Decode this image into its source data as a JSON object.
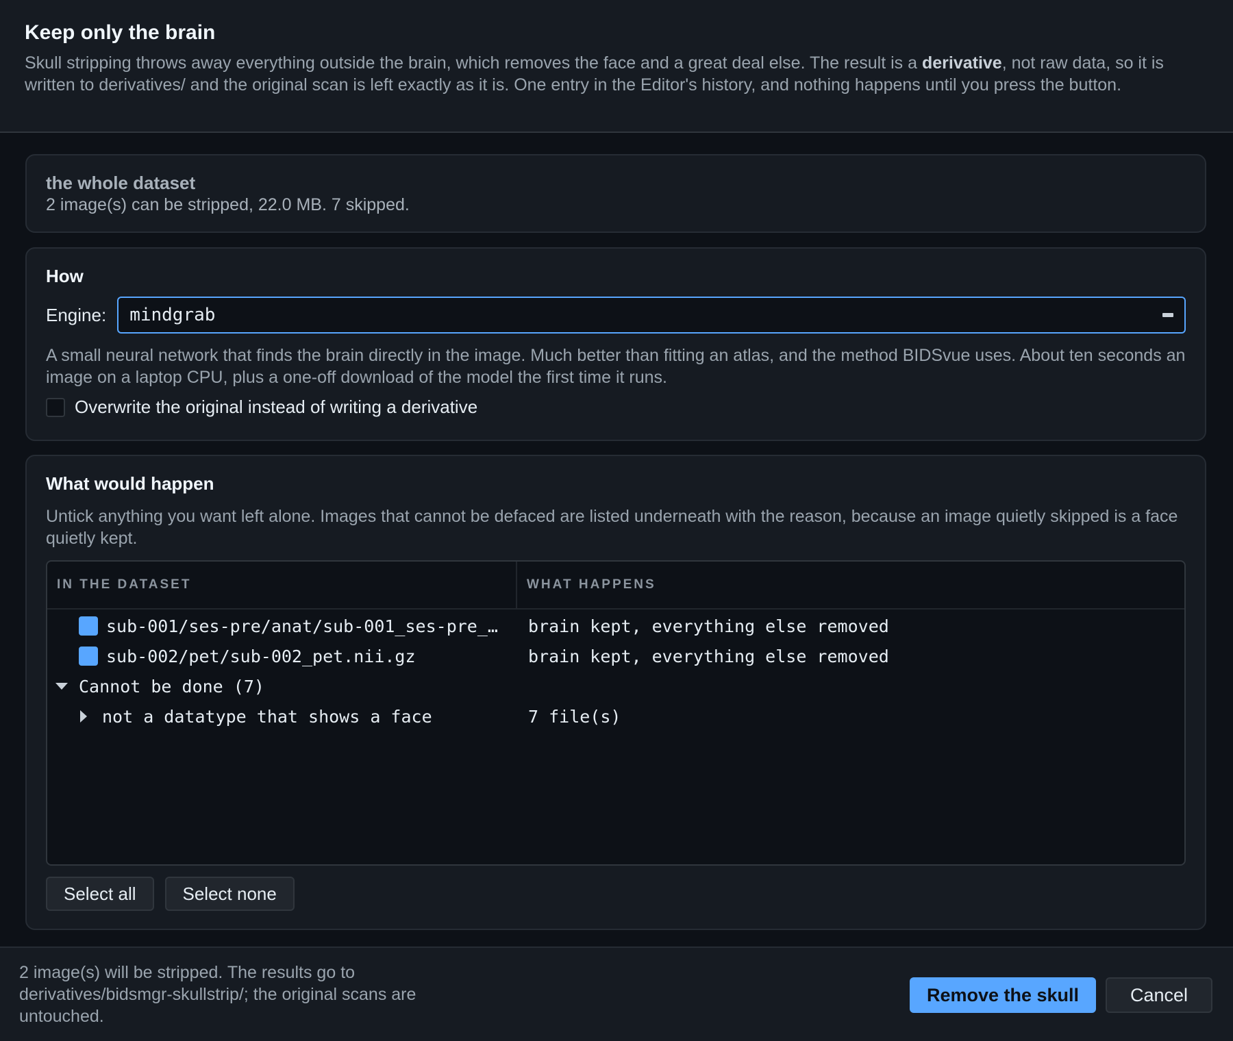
{
  "dialog": {
    "title": "Keep only the brain",
    "intro_pre": "Skull stripping throws away everything outside the brain, which removes the face and a great deal else. The result is a ",
    "intro_bold": "derivative",
    "intro_post": ", not raw data, so it is written to derivatives/ and the original scan is left exactly as it is. One entry in the Editor's history, and nothing happens until you press the button."
  },
  "scope": {
    "name": "the whole dataset",
    "summary": "2 image(s) can be stripped, 22.0 MB. 7 skipped."
  },
  "how": {
    "title": "How",
    "engine_label": "Engine:",
    "engine_value": "mindgrab",
    "description": "A small neural network that finds the brain directly in the image. Much better than fitting an atlas, and the method BIDSvue uses. About ten seconds an image on a laptop CPU, plus a one-off download of the model the first time it runs.",
    "overwrite_label": "Overwrite the original instead of writing a derivative",
    "overwrite_checked": false
  },
  "what": {
    "title": "What would happen",
    "description": "Untick anything you want left alone. Images that cannot be defaced are listed underneath with the reason, because an image quietly skipped is a face quietly kept.",
    "columns": [
      "IN THE DATASET",
      "WHAT HAPPENS"
    ],
    "rows": [
      {
        "path": "sub-001/ses-pre/anat/sub-001_ses-pre_…",
        "result": "brain kept, everything else removed",
        "checked": true
      },
      {
        "path": "sub-002/pet/sub-002_pet.nii.gz",
        "result": "brain kept, everything else removed",
        "checked": true
      }
    ],
    "skipped_group": "Cannot be done (7)",
    "skipped_reason": "not a datatype that shows a face",
    "skipped_count": "7 file(s)",
    "select_all": "Select all",
    "select_none": "Select none"
  },
  "footer": {
    "summary": "2 image(s) will be stripped. The results go to derivatives/bidsmgr-skullstrip/; the original scans are untouched.",
    "primary_label": "Remove the skull",
    "cancel_label": "Cancel"
  },
  "colors": {
    "accent": "#58a6ff",
    "background": "#0d1117",
    "panel": "#161b22"
  },
  "icons": {
    "engine_select": "select-handle-icon",
    "group_expanded": "triangle-down-icon",
    "group_collapsed": "triangle-right-icon"
  }
}
